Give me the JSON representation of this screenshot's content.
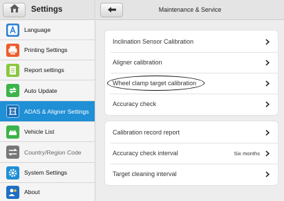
{
  "sidebar": {
    "title": "Settings",
    "items": [
      {
        "label": "Language",
        "icon": "language-icon",
        "color": "#2b7fd4",
        "state": "normal"
      },
      {
        "label": "Printing Settings",
        "icon": "printer-icon",
        "color": "#f05a2a",
        "state": "normal"
      },
      {
        "label": "Report settings",
        "icon": "report-icon",
        "color": "#8cc63f",
        "state": "normal"
      },
      {
        "label": "Auto Update",
        "icon": "update-icon",
        "color": "#3cb34a",
        "state": "normal"
      },
      {
        "label": "ADAS & Aligner Settings",
        "icon": "adas-icon",
        "color": "#1a6db5",
        "state": "active"
      },
      {
        "label": "Vehicle List",
        "icon": "vehicle-list-icon",
        "color": "#3cb34a",
        "state": "normal"
      },
      {
        "label": "Country/Region Code",
        "icon": "region-code-icon",
        "color": "#777777",
        "state": "disabled"
      },
      {
        "label": "System Settings",
        "icon": "system-settings-icon",
        "color": "#1f8fd6",
        "state": "normal"
      },
      {
        "label": "About",
        "icon": "about-icon",
        "color": "#1f6fc4",
        "state": "normal"
      }
    ]
  },
  "main": {
    "title": "Maintenance & Service",
    "groups": [
      {
        "rows": [
          {
            "label": "Inclination Sensor Calibration",
            "value": ""
          },
          {
            "label": "Aligner calibration",
            "value": ""
          },
          {
            "label": "Wheel clamp target calibration",
            "value": "",
            "circled": true
          },
          {
            "label": "Accuracy check",
            "value": ""
          }
        ]
      },
      {
        "rows": [
          {
            "label": "Calibration record report",
            "value": ""
          },
          {
            "label": "Accuracy check interval",
            "value": "Six months"
          },
          {
            "label": "Target cleaning interval",
            "value": ""
          }
        ]
      }
    ]
  },
  "colors": {
    "accent": "#1f8fd6",
    "background": "#ededed",
    "card": "#ffffff"
  }
}
